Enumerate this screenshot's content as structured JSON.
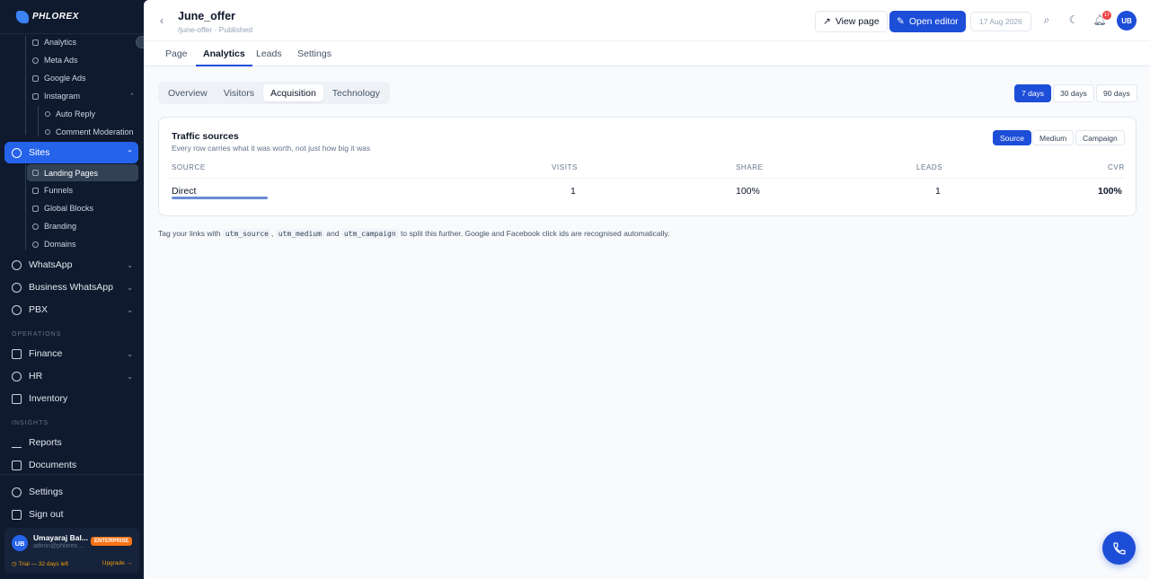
{
  "brand": {
    "name": "PHLOREX"
  },
  "sidebar": {
    "marketing_sub": [
      {
        "label": "Analytics",
        "icon": "bar-chart-icon"
      },
      {
        "label": "Meta Ads",
        "icon": "globe-icon"
      },
      {
        "label": "Google Ads",
        "icon": "bar-chart-icon"
      },
      {
        "label": "Instagram",
        "icon": "instagram-icon"
      }
    ],
    "instagram_sub": [
      {
        "label": "Auto Reply",
        "icon": "chat-icon"
      },
      {
        "label": "Comment Moderation",
        "icon": "shield-icon"
      }
    ],
    "sites": {
      "label": "Sites",
      "icon": "globe-icon"
    },
    "sites_sub": [
      {
        "label": "Landing Pages",
        "icon": "layout-icon"
      },
      {
        "label": "Funnels",
        "icon": "funnel-icon"
      },
      {
        "label": "Global Blocks",
        "icon": "blocks-icon"
      },
      {
        "label": "Branding",
        "icon": "palette-icon"
      },
      {
        "label": "Domains",
        "icon": "globe-icon"
      }
    ],
    "nav1": [
      {
        "label": "WhatsApp",
        "icon": "whatsapp-icon"
      },
      {
        "label": "Business WhatsApp",
        "icon": "check-circle-icon"
      },
      {
        "label": "PBX",
        "icon": "phone-icon"
      }
    ],
    "section_operations": "OPERATIONS",
    "nav2": [
      {
        "label": "Finance",
        "icon": "bank-icon"
      },
      {
        "label": "HR",
        "icon": "users-icon"
      },
      {
        "label": "Inventory",
        "icon": "box-icon"
      }
    ],
    "section_insights": "INSIGHTS",
    "nav3": [
      {
        "label": "Reports",
        "icon": "trend-icon"
      },
      {
        "label": "Documents",
        "icon": "folder-icon"
      }
    ],
    "bottom": [
      {
        "label": "Settings",
        "icon": "gear-icon"
      },
      {
        "label": "Sign out",
        "icon": "logout-icon"
      }
    ],
    "user": {
      "initials": "UB",
      "name": "Umayaraj Bal...",
      "email": "admin@phlorex....",
      "plan": "ENTERPRISE",
      "trial": "◷ Trial — 32 days left",
      "upgrade": "Upgrade →"
    }
  },
  "header": {
    "back": "‹",
    "title": "June_offer",
    "subtitle": "/june-offer · Published",
    "view_page": "View page",
    "open_editor": "Open editor",
    "date": "17 Aug 2026",
    "notifications": "17",
    "avatar": "UB"
  },
  "tabs": [
    "Page",
    "Analytics",
    "Leads",
    "Settings"
  ],
  "active_tab": "Analytics",
  "subtabs": [
    "Overview",
    "Visitors",
    "Acquisition",
    "Technology"
  ],
  "active_subtab": "Acquisition",
  "ranges": [
    "7 days",
    "30 days",
    "90 days"
  ],
  "active_range": "7 days",
  "traffic": {
    "title": "Traffic sources",
    "subtitle": "Every row carries what it was worth, not just how big it was",
    "groupings": [
      "Source",
      "Medium",
      "Campaign"
    ],
    "active_grouping": "Source",
    "columns": [
      "SOURCE",
      "VISITS",
      "SHARE",
      "LEADS",
      "CVR"
    ],
    "rows": [
      {
        "source": "Direct",
        "visits": "1",
        "share": "100%",
        "leads": "1",
        "cvr": "100%",
        "share_fraction": 1.0
      }
    ]
  },
  "hint": {
    "prefix": "Tag your links with",
    "code1": "utm_source",
    "sep1": ",",
    "code2": "utm_medium",
    "sep2": "and",
    "code3": "utm_campaign",
    "suffix": "to split this further. Google and Facebook click ids are recognised automatically."
  },
  "colors": {
    "accent": "#1d4ed8",
    "sidebar_bg": "#0f1a2e",
    "badge": "#ef4444",
    "plan": "#f97316"
  }
}
